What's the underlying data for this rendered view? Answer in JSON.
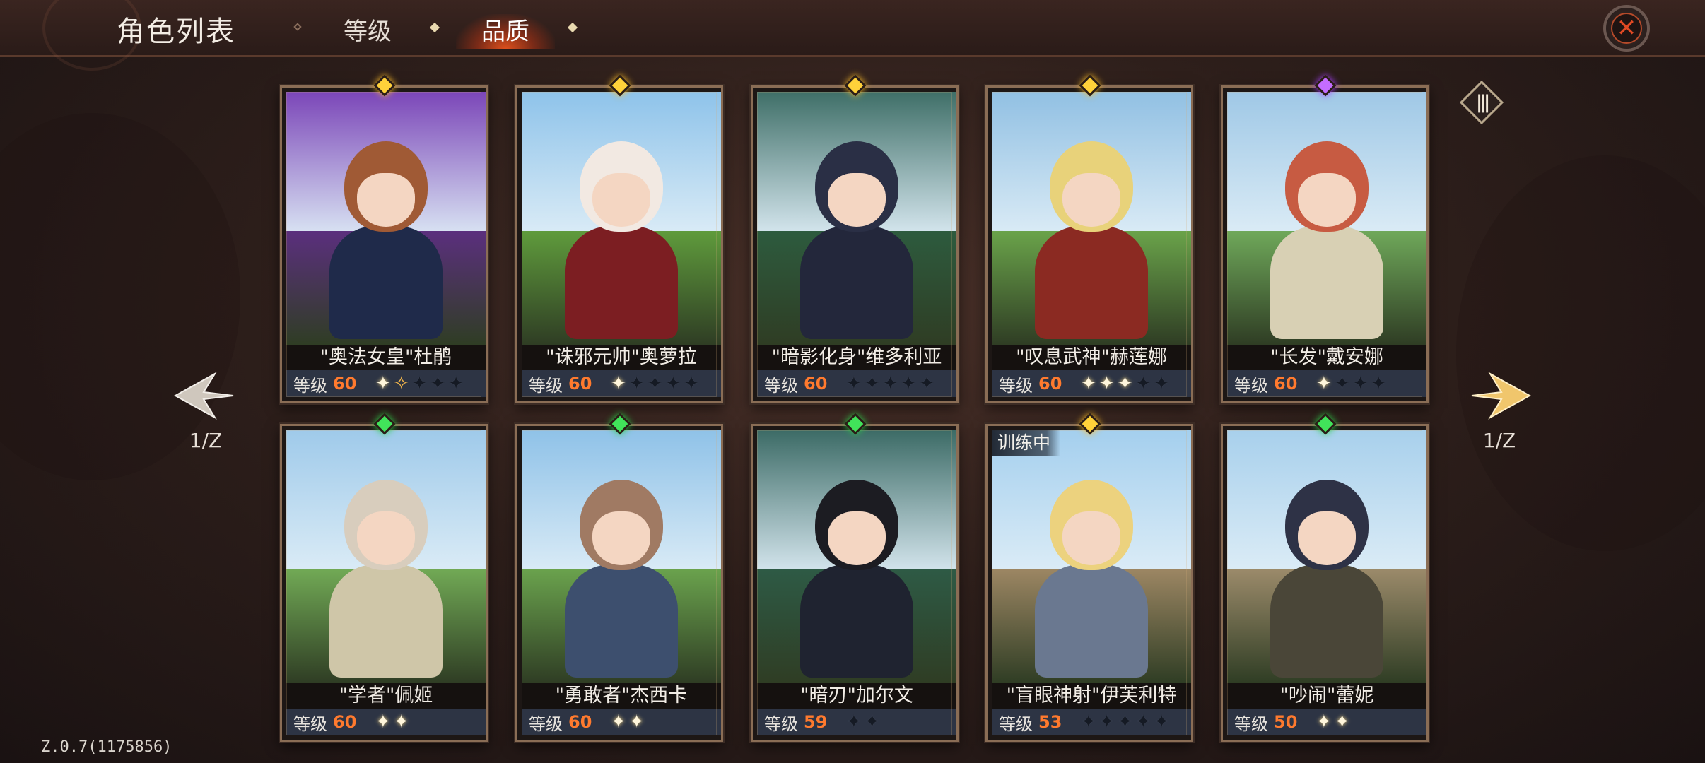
{
  "header": {
    "title": "角色列表",
    "tabs": [
      {
        "label": "等级",
        "active": false
      },
      {
        "label": "品质",
        "active": true
      }
    ],
    "close_icon": "close-x-icon"
  },
  "pagination": {
    "left_indicator": "1/Z",
    "right_indicator": "1/Z"
  },
  "level_label": "等级",
  "characters": [
    {
      "name": "\"奥法女皇\"杜鹃",
      "level": "60",
      "gem": "gold",
      "stars_filled": 1,
      "stars_half": 1,
      "stars_total": 5,
      "training": ""
    },
    {
      "name": "\"诛邪元帅\"奥萝拉",
      "level": "60",
      "gem": "gold",
      "stars_filled": 1,
      "stars_half": 0,
      "stars_total": 5,
      "training": ""
    },
    {
      "name": "\"暗影化身\"维多利亚",
      "level": "60",
      "gem": "gold",
      "stars_filled": 0,
      "stars_half": 0,
      "stars_total": 5,
      "training": ""
    },
    {
      "name": "\"叹息武神\"赫莲娜",
      "level": "60",
      "gem": "gold",
      "stars_filled": 3,
      "stars_half": 0,
      "stars_total": 5,
      "training": ""
    },
    {
      "name": "\"长发\"戴安娜",
      "level": "60",
      "gem": "purple",
      "stars_filled": 1,
      "stars_half": 0,
      "stars_total": 4,
      "training": ""
    },
    {
      "name": "\"学者\"佩姬",
      "level": "60",
      "gem": "green",
      "stars_filled": 2,
      "stars_half": 0,
      "stars_total": 2,
      "training": ""
    },
    {
      "name": "\"勇敢者\"杰西卡",
      "level": "60",
      "gem": "green",
      "stars_filled": 2,
      "stars_half": 0,
      "stars_total": 2,
      "training": ""
    },
    {
      "name": "\"暗刃\"加尔文",
      "level": "59",
      "gem": "green",
      "stars_filled": 0,
      "stars_half": 0,
      "stars_total": 2,
      "training": ""
    },
    {
      "name": "\"盲眼神射\"伊芙利特",
      "level": "53",
      "gem": "gold",
      "stars_filled": 0,
      "stars_half": 0,
      "stars_total": 5,
      "training": "训练中"
    },
    {
      "name": "\"吵闹\"蕾妮",
      "level": "50",
      "gem": "green",
      "stars_filled": 2,
      "stars_half": 0,
      "stars_total": 2,
      "training": ""
    }
  ],
  "version": "Z.0.7(1175856)",
  "icons": {
    "prev": "arrow-left-icon",
    "next": "arrow-right-icon",
    "grid": "grid-toggle-icon"
  }
}
